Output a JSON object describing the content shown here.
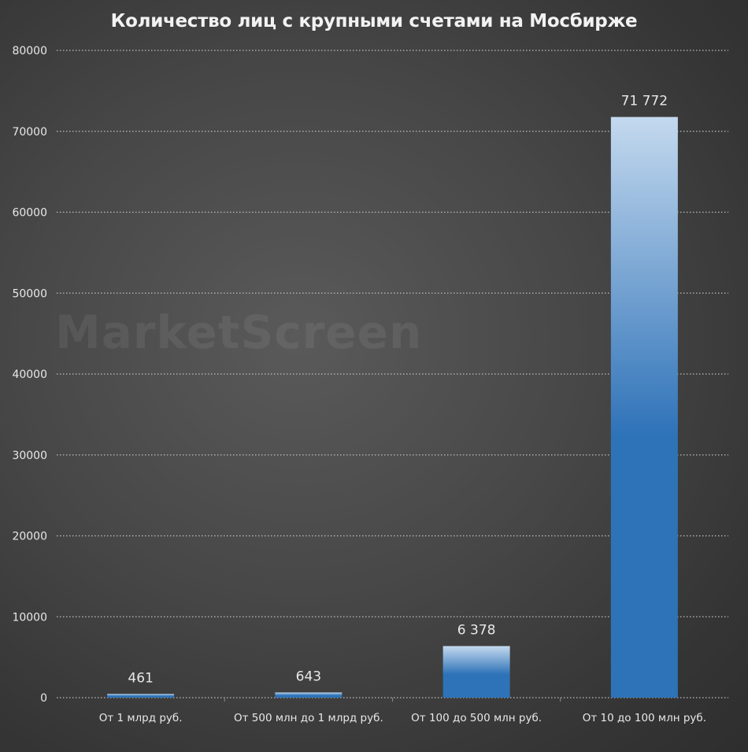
{
  "watermark": "MarketScreen",
  "chart_data": {
    "type": "bar",
    "title": "Количество лиц с крупными счетами на Мосбирже",
    "xlabel": "",
    "ylabel": "",
    "categories": [
      "От 1 млрд руб.",
      "От 500 млн до 1 млрд руб.",
      "От 100 до 500 млн руб.",
      "От 10 до 100 млн руб."
    ],
    "values": [
      461,
      643,
      6378,
      71772
    ],
    "data_labels": [
      "461",
      "643",
      "6 378",
      "71 772"
    ],
    "ylim": [
      0,
      80000
    ],
    "yticks": [
      0,
      10000,
      20000,
      30000,
      40000,
      50000,
      60000,
      70000,
      80000
    ],
    "ytick_labels": [
      "0",
      "10000",
      "20000",
      "30000",
      "40000",
      "50000",
      "60000",
      "70000",
      "80000"
    ],
    "grid": true,
    "legend": "none",
    "colors": {
      "bar_top": "#c4d9ee",
      "bar_mid": "#5d97cf",
      "bar_bottom": "#2e72b8",
      "text": "#e8e8e8",
      "grid": "#bfbfbf"
    }
  }
}
